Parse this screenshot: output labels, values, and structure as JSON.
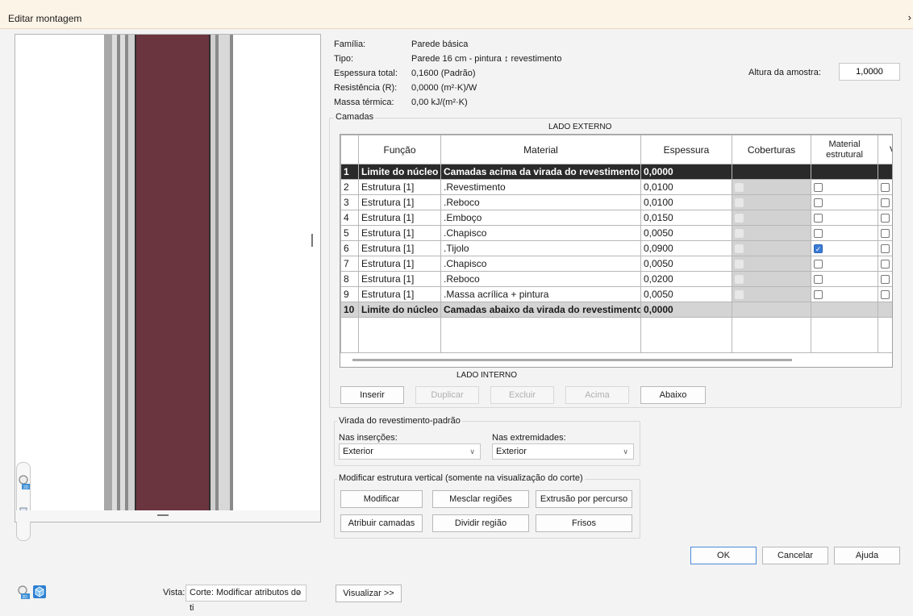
{
  "window": {
    "title": "Editar montagem",
    "close": "×"
  },
  "properties": {
    "familia_label": "Família:",
    "familia_value": "Parede básica",
    "tipo_label": "Tipo:",
    "tipo_value": "Parede 16 cm - pintura ↕ revestimento",
    "espessura_label": "Espessura total:",
    "espessura_value": "0,1600 (Padrão)",
    "resistencia_label": "Resistência (R):",
    "resistencia_value": "0,0000 (m²·K)/W",
    "massa_label": "Massa térmica:",
    "massa_value": "0,00 kJ/(m²·K)",
    "altura_label": "Altura da amostra:",
    "altura_value": "1,0000"
  },
  "layers": {
    "group_label": "Camadas",
    "lado_externo": "LADO EXTERNO",
    "lado_interno": "LADO INTERNO",
    "columns": {
      "funcao": "Função",
      "material": "Material",
      "espessura": "Espessura",
      "coberturas": "Coberturas",
      "material_estrutural": "Material estrutural",
      "variavel": "V"
    },
    "rows": [
      {
        "n": "1",
        "funcao": "Limite do núcleo",
        "material": "Camadas acima da virada do revestimento",
        "espessura": "0,0000",
        "type": "core"
      },
      {
        "n": "2",
        "funcao": "Estrutura [1]",
        "material": ".Revestimento",
        "espessura": "0,0100",
        "estrutural": false
      },
      {
        "n": "3",
        "funcao": "Estrutura [1]",
        "material": ".Reboco",
        "espessura": "0,0100",
        "estrutural": false
      },
      {
        "n": "4",
        "funcao": "Estrutura [1]",
        "material": ".Emboço",
        "espessura": "0,0150",
        "estrutural": false
      },
      {
        "n": "5",
        "funcao": "Estrutura [1]",
        "material": ".Chapisco",
        "espessura": "0,0050",
        "estrutural": false
      },
      {
        "n": "6",
        "funcao": "Estrutura [1]",
        "material": ".Tijolo",
        "espessura": "0,0900",
        "estrutural": true
      },
      {
        "n": "7",
        "funcao": "Estrutura [1]",
        "material": ".Chapisco",
        "espessura": "0,0050",
        "estrutural": false
      },
      {
        "n": "8",
        "funcao": "Estrutura [1]",
        "material": ".Reboco",
        "espessura": "0,0200",
        "estrutural": false
      },
      {
        "n": "9",
        "funcao": "Estrutura [1]",
        "material": ".Massa acrílica + pintura",
        "espessura": "0,0050",
        "estrutural": false
      },
      {
        "n": "10",
        "funcao": "Limite do núcleo",
        "material": "Camadas abaixo da virada do revestimento",
        "espessura": "0,0000",
        "type": "core-gray"
      }
    ],
    "buttons": {
      "inserir": "Inserir",
      "duplicar": "Duplicar",
      "excluir": "Excluir",
      "acima": "Acima",
      "abaixo": "Abaixo"
    }
  },
  "wrapping": {
    "group_label": "Virada do revestimento-padrão",
    "insercoes_label": "Nas inserções:",
    "insercoes_value": "Exterior",
    "extremidades_label": "Nas extremidades:",
    "extremidades_value": "Exterior"
  },
  "vertical": {
    "group_label": "Modificar estrutura vertical (somente na visualização do corte)",
    "modificar": "Modificar",
    "mesclar": "Mesclar regiões",
    "extrusao": "Extrusão por percurso",
    "atribuir": "Atribuir camadas",
    "dividir": "Dividir região",
    "frisos": "Frisos"
  },
  "dialog_buttons": {
    "ok": "OK",
    "cancelar": "Cancelar",
    "ajuda": "Ajuda"
  },
  "footer": {
    "vista_label": "Vista:",
    "vista_value": "Corte: Modificar atributos do ti",
    "visualizar": "Visualizar >>"
  },
  "colors": {
    "brick": "#6b3540",
    "accent": "#3a7bd5"
  },
  "icons": [
    "zoom-2d-icon",
    "zoom-region-icon",
    "zoom-2d-footer-icon",
    "cube-3d-icon"
  ]
}
